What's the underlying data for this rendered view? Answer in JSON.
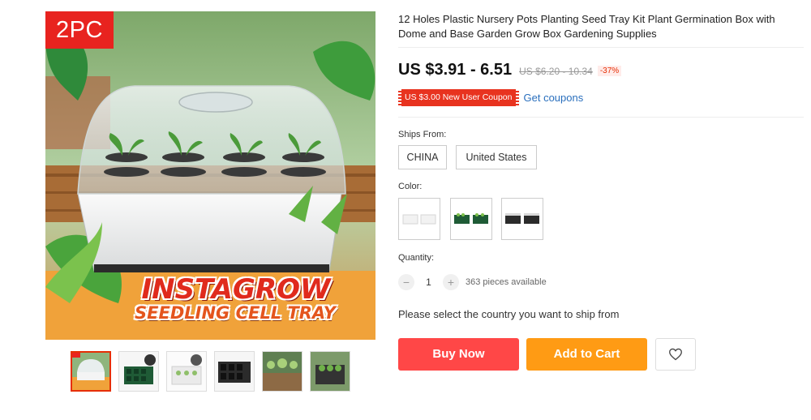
{
  "gallery": {
    "badge": "2PC",
    "banner_line1": "INSTAGROW",
    "banner_line2": "SEEDLING CELL TRAY",
    "thumbnails": [
      {
        "name": "white tray with lid"
      },
      {
        "name": "green tray"
      },
      {
        "name": "white tray top view"
      },
      {
        "name": "black tray"
      },
      {
        "name": "seedlings photo"
      },
      {
        "name": "tray with plants"
      }
    ],
    "active_thumbnail_index": 0
  },
  "product": {
    "title": "12 Holes Plastic Nursery Pots Planting Seed Tray Kit Plant Germination Box with Dome and Base Garden Grow Box Gardening Supplies",
    "price": "US $3.91 - 6.51",
    "old_price": "US $6.20 - 10.34",
    "discount": "-37%",
    "coupon_label": "US $3.00 New User Coupon",
    "get_coupons": "Get coupons"
  },
  "ships_from": {
    "label": "Ships From:",
    "options": [
      "CHINA",
      "United States"
    ]
  },
  "color": {
    "label": "Color:",
    "options": [
      {
        "name": "white",
        "swatch": "#f2f2f2"
      },
      {
        "name": "green",
        "swatch": "#1f5b36"
      },
      {
        "name": "black",
        "swatch": "#2b2b2b"
      }
    ]
  },
  "quantity": {
    "label": "Quantity:",
    "minus": "−",
    "plus": "+",
    "value": "1",
    "available": "363 pieces available"
  },
  "shipping_note": "Please select the country you want to ship from",
  "actions": {
    "buy_now": "Buy Now",
    "add_to_cart": "Add to Cart"
  },
  "colors": {
    "accent_red": "#ff4747",
    "accent_orange": "#ff9b14",
    "badge_red": "#e8231f",
    "link_blue": "#2a6fbd"
  }
}
